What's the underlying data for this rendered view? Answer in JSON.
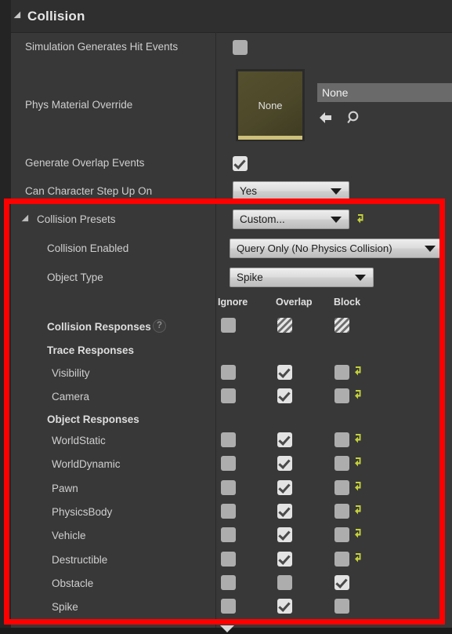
{
  "category": {
    "title": "Collision",
    "expander_icon": "triangle-down-icon"
  },
  "top_properties": {
    "simulation_hit_events": {
      "label": "Simulation Generates Hit Events",
      "checked": false
    },
    "phys_material_override": {
      "label": "Phys Material Override",
      "thumbnail_text": "None",
      "asset_value": "None",
      "browse_icon": "back-arrow-icon",
      "search_icon": "magnifier-icon"
    },
    "generate_overlap_events": {
      "label": "Generate Overlap Events",
      "checked": true
    },
    "can_character_step_up_on": {
      "label": "Can Character Step Up On",
      "value": "Yes",
      "dropdown_icon": "chevron-down-icon"
    }
  },
  "collision_presets": {
    "label": "Collision Presets",
    "value": "Custom...",
    "reset_icon": "reset-arrow-icon",
    "expander_icon": "triangle-down-icon"
  },
  "collision_enabled": {
    "label": "Collision Enabled",
    "value": "Query Only (No Physics Collision)"
  },
  "object_type": {
    "label": "Object Type",
    "value": "Spike"
  },
  "response_matrix": {
    "columns": [
      "Ignore",
      "Overlap",
      "Block"
    ],
    "header_row": {
      "label": "Collision Responses",
      "help_icon": "question-mark-icon",
      "help_text": "?",
      "states": [
        "unchecked",
        "mixed",
        "mixed"
      ],
      "reset": false
    },
    "groups": [
      {
        "title": "Trace Responses",
        "rows": [
          {
            "label": "Visibility",
            "states": [
              "unchecked",
              "checked",
              "unchecked"
            ],
            "reset": true
          },
          {
            "label": "Camera",
            "states": [
              "unchecked",
              "checked",
              "unchecked"
            ],
            "reset": true
          }
        ]
      },
      {
        "title": "Object Responses",
        "rows": [
          {
            "label": "WorldStatic",
            "states": [
              "unchecked",
              "checked",
              "unchecked"
            ],
            "reset": true
          },
          {
            "label": "WorldDynamic",
            "states": [
              "unchecked",
              "checked",
              "unchecked"
            ],
            "reset": true
          },
          {
            "label": "Pawn",
            "states": [
              "unchecked",
              "checked",
              "unchecked"
            ],
            "reset": true
          },
          {
            "label": "PhysicsBody",
            "states": [
              "unchecked",
              "checked",
              "unchecked"
            ],
            "reset": true
          },
          {
            "label": "Vehicle",
            "states": [
              "unchecked",
              "checked",
              "unchecked"
            ],
            "reset": true
          },
          {
            "label": "Destructible",
            "states": [
              "unchecked",
              "checked",
              "unchecked"
            ],
            "reset": true
          },
          {
            "label": "Obstacle",
            "states": [
              "unchecked",
              "unchecked",
              "checked"
            ],
            "reset": false
          },
          {
            "label": "Spike",
            "states": [
              "unchecked",
              "checked",
              "unchecked"
            ],
            "reset": false
          }
        ]
      }
    ]
  },
  "scroll_arrow_icon": "triangle-down-icon",
  "colors": {
    "panel_bg": "#383838",
    "header_bg": "#2f2f2f",
    "highlight": "#fe0000",
    "reset_arrow": "#c4d13c",
    "checkbox_unchecked": "#adadad",
    "checkbox_checked": "#e3e3e3",
    "thumbnail_accent": "#cdc07a"
  }
}
